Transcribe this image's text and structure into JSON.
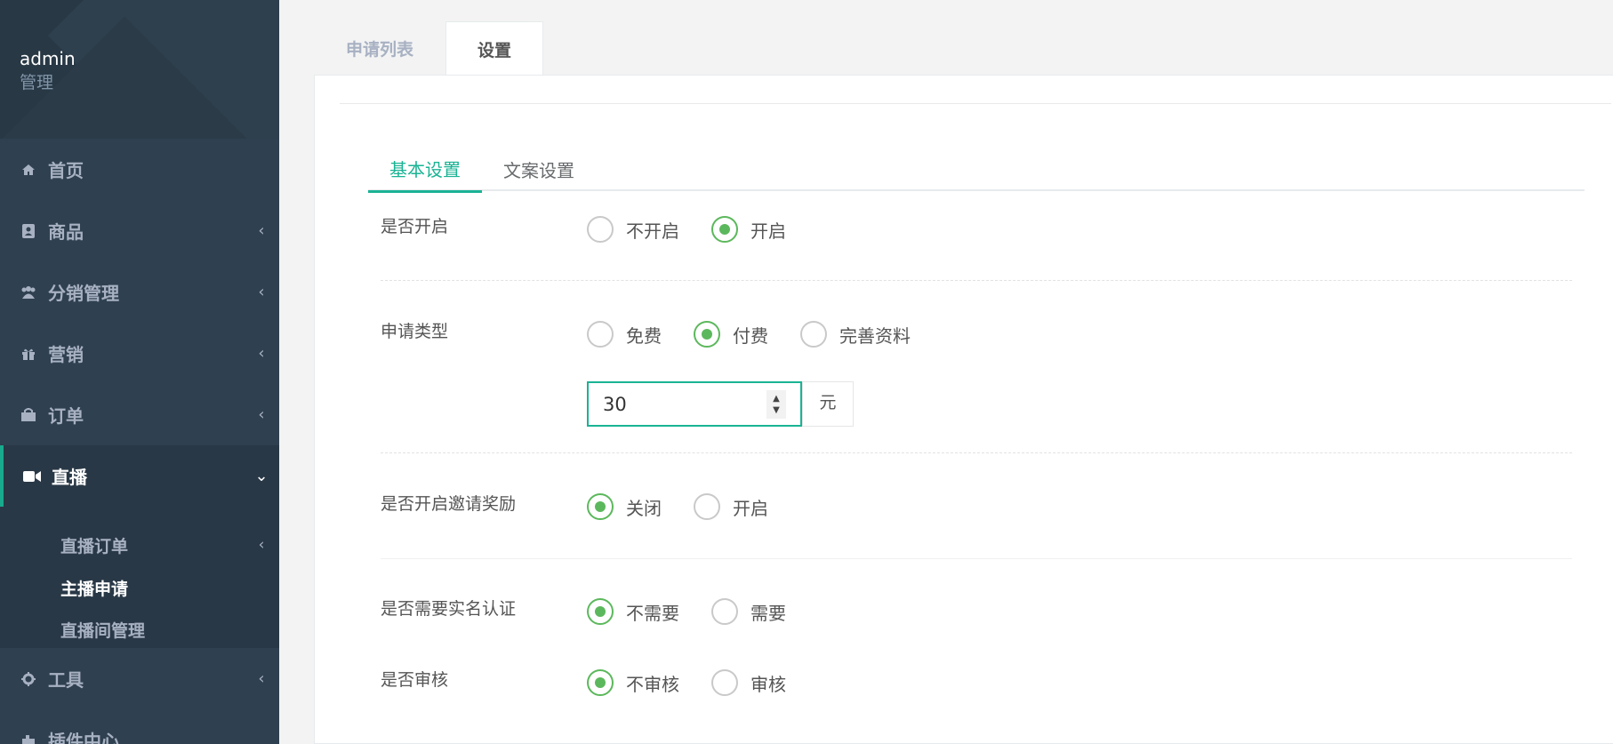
{
  "profile": {
    "name": "admin",
    "role": "管理"
  },
  "nav": {
    "home": "首页",
    "goods": "商品",
    "distribution": "分销管理",
    "marketing": "营销",
    "orders": "订单",
    "live": "直播",
    "live_sub": [
      "直播订单",
      "主播申请",
      "直播间管理"
    ],
    "tools": "工具",
    "plugins": "插件中心"
  },
  "top_tabs": {
    "list": "申请列表",
    "settings": "设置"
  },
  "sub_tabs": {
    "basic": "基本设置",
    "copy": "文案设置"
  },
  "form": {
    "enable": {
      "label": "是否开启",
      "options": [
        "不开启",
        "开启"
      ],
      "selected": "开启"
    },
    "apply_type": {
      "label": "申请类型",
      "options": [
        "免费",
        "付费",
        "完善资料"
      ],
      "selected": "付费",
      "amount": "30",
      "unit": "元"
    },
    "invite_reward": {
      "label": "是否开启邀请奖励",
      "options": [
        "关闭",
        "开启"
      ],
      "selected": "关闭"
    },
    "real_name": {
      "label": "是否需要实名认证",
      "options": [
        "不需要",
        "需要"
      ],
      "selected": "不需要"
    },
    "review": {
      "label": "是否审核",
      "options": [
        "不审核",
        "审核"
      ],
      "selected": "不审核"
    }
  },
  "colors": {
    "sidebar": "#2f4050",
    "accent": "#1ab394",
    "radio": "#5cb85c"
  }
}
